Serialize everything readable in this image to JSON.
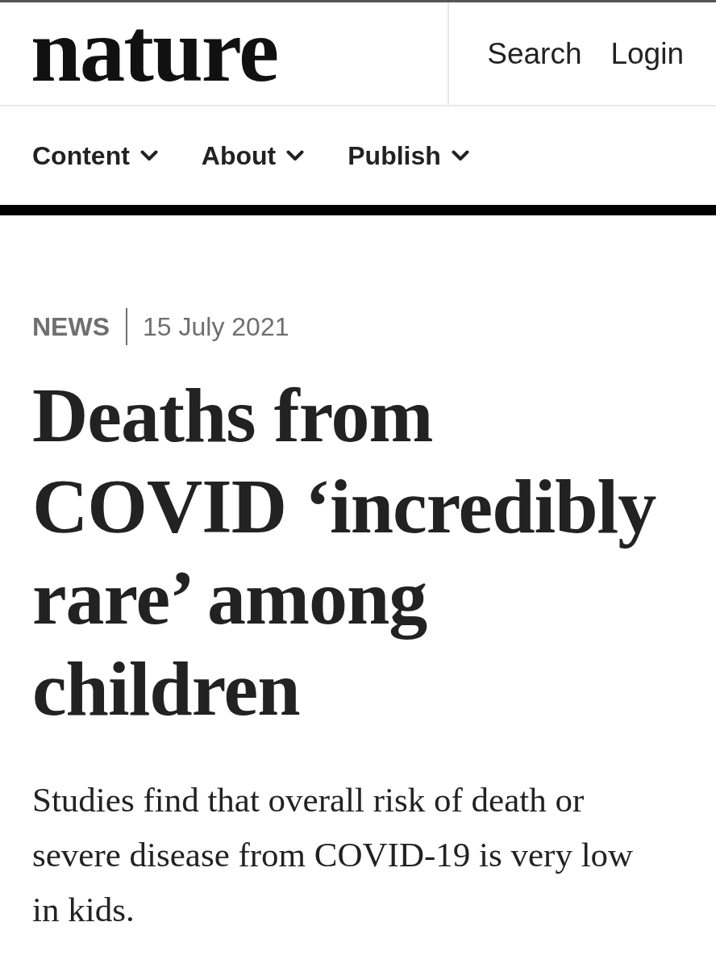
{
  "header": {
    "logo": "nature",
    "links": [
      {
        "label": "Search"
      },
      {
        "label": "Login"
      }
    ]
  },
  "nav": {
    "items": [
      {
        "label": "Content"
      },
      {
        "label": "About"
      },
      {
        "label": "Publish"
      }
    ]
  },
  "article": {
    "type": "NEWS",
    "date": "15 July 2021",
    "title": "Deaths from COVID ‘incredibly rare’ among children",
    "standfirst": "Studies find that overall risk of death or severe disease from COVID-19 is very low in kids."
  }
}
